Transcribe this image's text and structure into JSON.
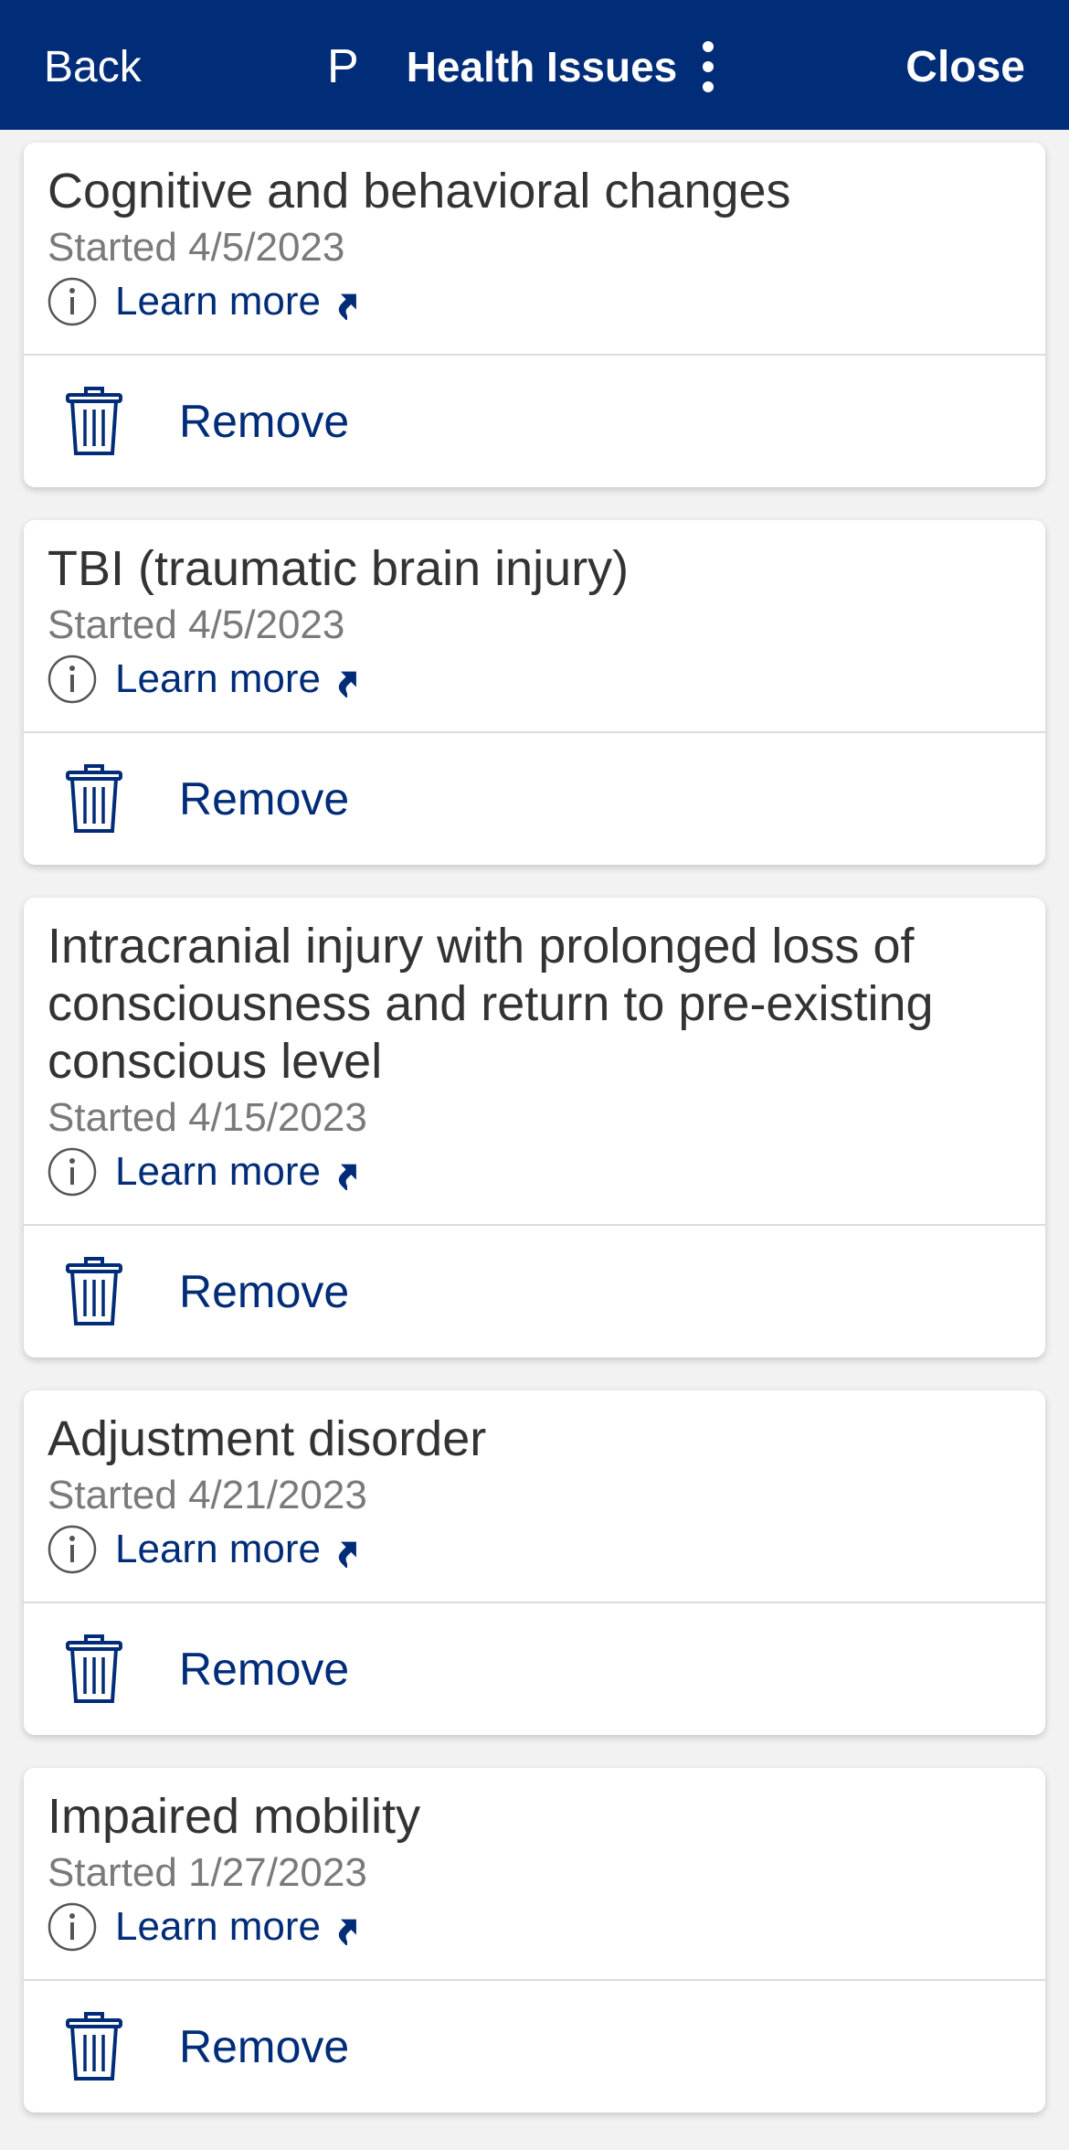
{
  "header": {
    "back_label": "Back",
    "avatar_letter": "P",
    "title": "Health Issues",
    "close_label": "Close",
    "background_color": "#012c78",
    "menu_icon": "kebab-menu-icon"
  },
  "issues": [
    {
      "title": "Cognitive and behavioral changes",
      "started": "Started 4/5/2023",
      "learn_more": "Learn more",
      "remove": "Remove"
    },
    {
      "title": "TBI (traumatic brain injury)",
      "started": "Started 4/5/2023",
      "learn_more": "Learn more",
      "remove": "Remove"
    },
    {
      "title": "Intracranial injury with prolonged loss of consciousness and return to pre-existing conscious level",
      "started": "Started 4/15/2023",
      "learn_more": "Learn more",
      "remove": "Remove"
    },
    {
      "title": "Adjustment disorder",
      "started": "Started 4/21/2023",
      "learn_more": "Learn more",
      "remove": "Remove"
    },
    {
      "title": "Impaired mobility",
      "started": "Started 1/27/2023",
      "learn_more": "Learn more",
      "remove": "Remove"
    }
  ],
  "icons": {
    "info": "info-icon",
    "external": "external-link-icon",
    "trash": "trash-icon"
  },
  "colors": {
    "accent": "#012c78",
    "title_text": "#333333",
    "secondary_text": "#7a7a7a"
  }
}
